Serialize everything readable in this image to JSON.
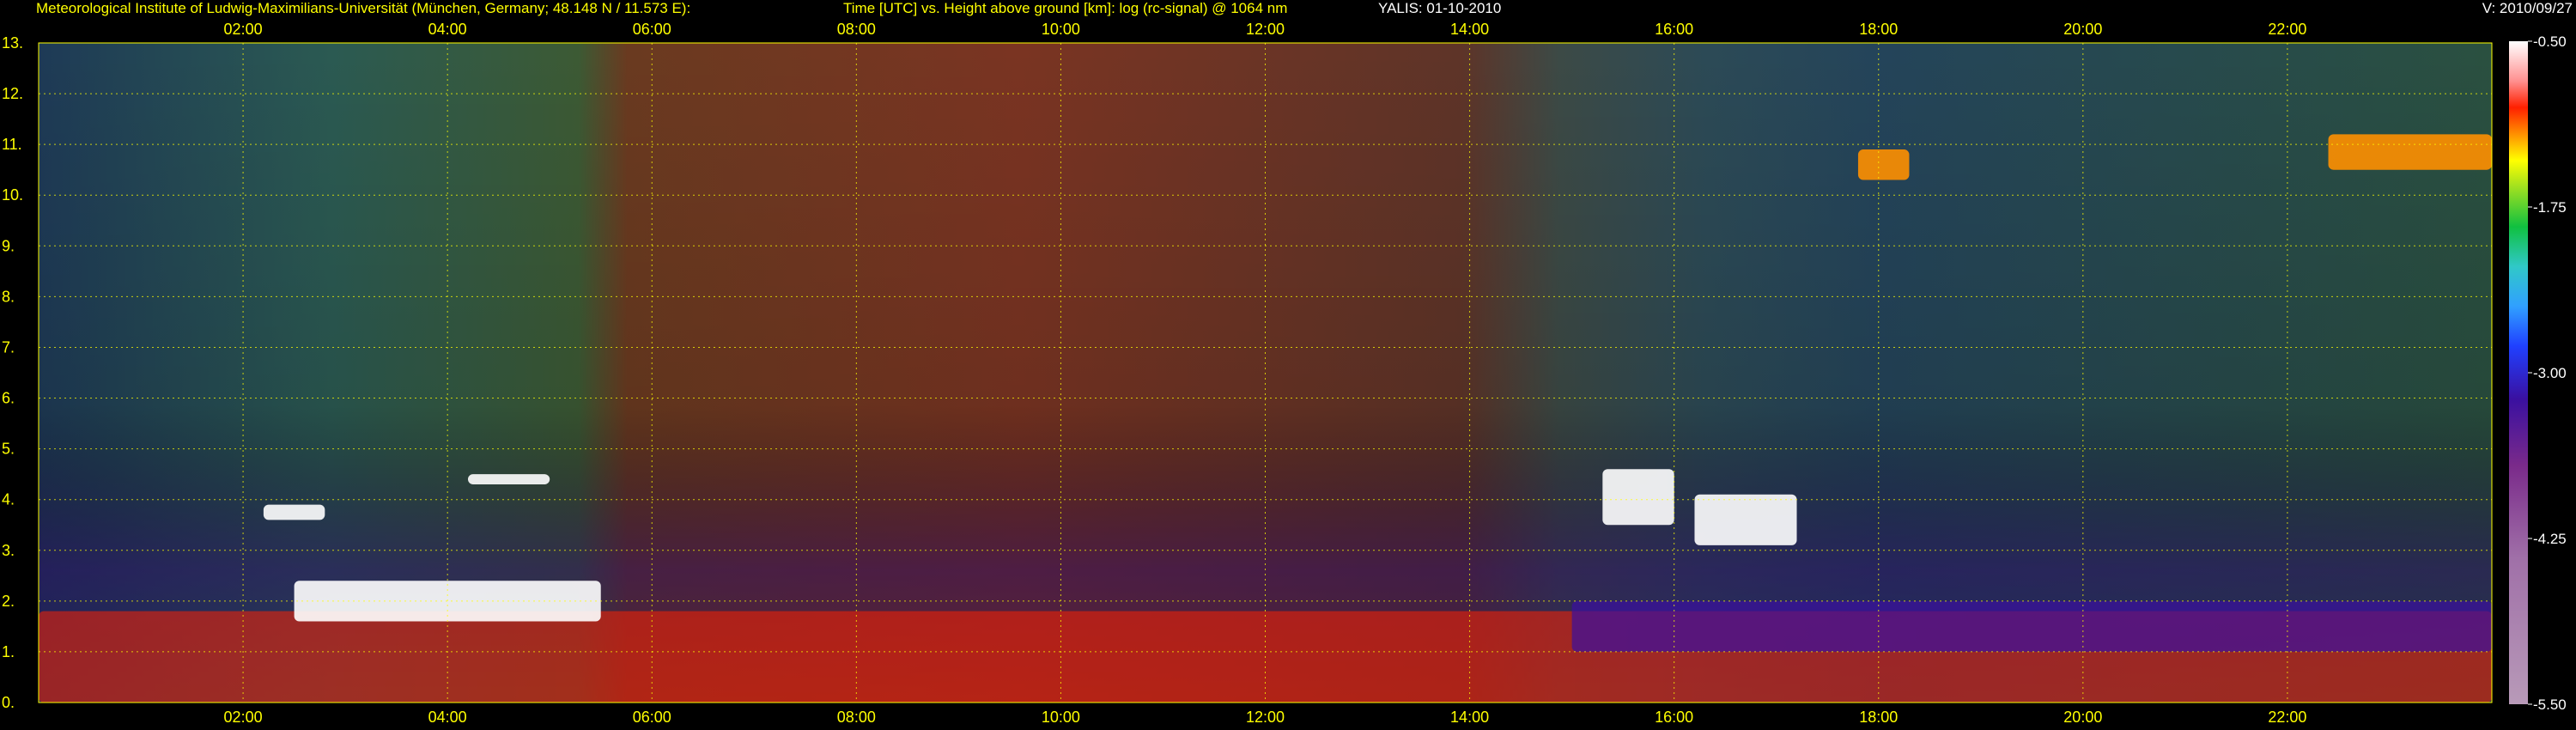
{
  "header": {
    "institute": "Meteorological Institute of Ludwig-Maximilians-Universität (München, Germany; 48.148 N / 11.573 E):",
    "plot_title": "Time [UTC] vs. Height above ground [km]: log (rc-signal) @ 1064 nm",
    "station_date": "YALIS: 01-10-2010",
    "version": "V: 2010/09/27"
  },
  "chart_data": {
    "type": "heatmap",
    "quantity": "log (rc-signal) @ 1064 nm",
    "x": {
      "label": "Time [UTC]",
      "range_hours": [
        0,
        24
      ],
      "ticks": [
        "02:00",
        "04:00",
        "06:00",
        "08:00",
        "10:00",
        "12:00",
        "14:00",
        "16:00",
        "18:00",
        "20:00",
        "22:00"
      ],
      "tick_hours": [
        2,
        4,
        6,
        8,
        10,
        12,
        14,
        16,
        18,
        20,
        22
      ]
    },
    "y": {
      "label": "Height above ground [km]",
      "range": [
        0,
        13
      ],
      "ticks": [
        "0.",
        "1.",
        "2.",
        "3.",
        "4.",
        "5.",
        "6.",
        "7.",
        "8.",
        "9.",
        "10.",
        "11.",
        "12.",
        "13."
      ],
      "tick_values": [
        0,
        1,
        2,
        3,
        4,
        5,
        6,
        7,
        8,
        9,
        10,
        11,
        12,
        13
      ]
    },
    "colorbar": {
      "range": [
        -5.5,
        -0.5
      ],
      "ticks": [
        "-0.50",
        "-1.75",
        "-3.00",
        "-4.25",
        "-5.50"
      ],
      "tick_values": [
        -0.5,
        -1.75,
        -3.0,
        -4.25,
        -5.5
      ]
    },
    "grid": true,
    "features": [
      {
        "name": "boundary layer",
        "hours": [
          0,
          24
        ],
        "km": [
          0,
          1.8
        ],
        "value": -1.0
      },
      {
        "name": "aerosol layer top",
        "hours": [
          2.5,
          5.5
        ],
        "km": [
          1.6,
          2.4
        ],
        "value": -0.6
      },
      {
        "name": "cloud",
        "hours": [
          2.2,
          2.8
        ],
        "km": [
          3.6,
          3.9
        ],
        "value": -0.6
      },
      {
        "name": "cloud",
        "hours": [
          4.2,
          5.0
        ],
        "km": [
          4.3,
          4.5
        ],
        "value": -0.7
      },
      {
        "name": "cloud",
        "hours": [
          15.3,
          16.0
        ],
        "km": [
          3.5,
          4.6
        ],
        "value": -0.6
      },
      {
        "name": "cloud",
        "hours": [
          16.2,
          17.2
        ],
        "km": [
          3.1,
          4.1
        ],
        "value": -0.6
      },
      {
        "name": "cirrus",
        "hours": [
          17.8,
          18.3
        ],
        "km": [
          10.3,
          10.9
        ],
        "value": -1.2
      },
      {
        "name": "cirrus",
        "hours": [
          22.4,
          24.0
        ],
        "km": [
          10.5,
          11.2
        ],
        "value": -1.3
      },
      {
        "name": "residual layer",
        "hours": [
          15.0,
          24.0
        ],
        "km": [
          1.0,
          2.0
        ],
        "value": -3.6
      }
    ]
  }
}
